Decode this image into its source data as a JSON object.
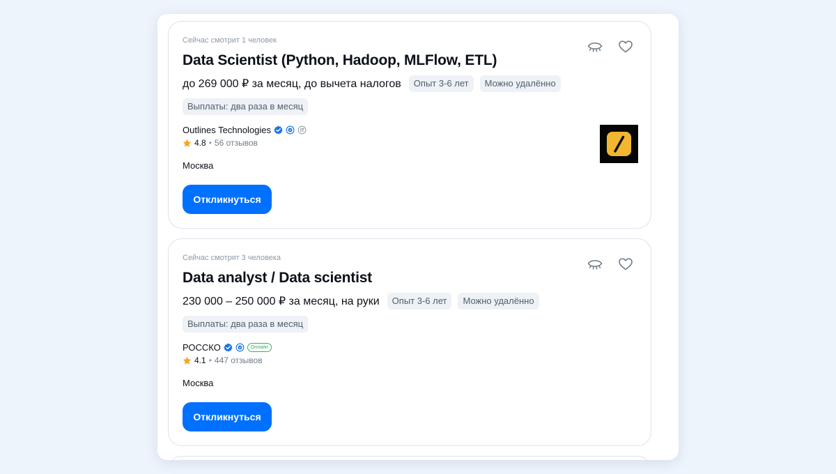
{
  "vacancies": [
    {
      "viewers": "Сейчас смотрит 1 человек",
      "title": "Data Scientist (Python, Hadoop, MLFlow, ETL)",
      "salary": "до 269 000 ₽ за месяц, до вычета налогов",
      "experience": "Опыт 3-6 лет",
      "remote": "Можно удалённо",
      "payments": "Выплаты: два раза в месяц",
      "company": "Outlines Technologies",
      "rating": "4.8",
      "separator": "•",
      "reviews": "56 отзывов",
      "city": "Москва",
      "apply_label": "Откликнуться",
      "icons": [
        "verified-icon",
        "trusted-employer-icon",
        "accredited-it-icon"
      ]
    },
    {
      "viewers": "Сейчас смотрят 3 человека",
      "title": "Data analyst / Data scientist",
      "salary": "230 000 – 250 000 ₽ за месяц, на руки",
      "experience": "Опыт 3-6 лет",
      "remote": "Можно удалённо",
      "payments": "Выплаты: два раза в месяц",
      "company": "РОССКО",
      "online_badge": "Онлайн",
      "rating": "4.1",
      "separator": "•",
      "reviews": "447 отзывов",
      "city": "Москва",
      "apply_label": "Откликнуться",
      "icons": [
        "verified-icon",
        "trusted-employer-icon"
      ]
    }
  ],
  "colors": {
    "accent": "#0070ff",
    "star": "#f5a623",
    "verified": "#1a73e8",
    "online": "#2eb65c",
    "logo_yellow": "#f2b630"
  }
}
